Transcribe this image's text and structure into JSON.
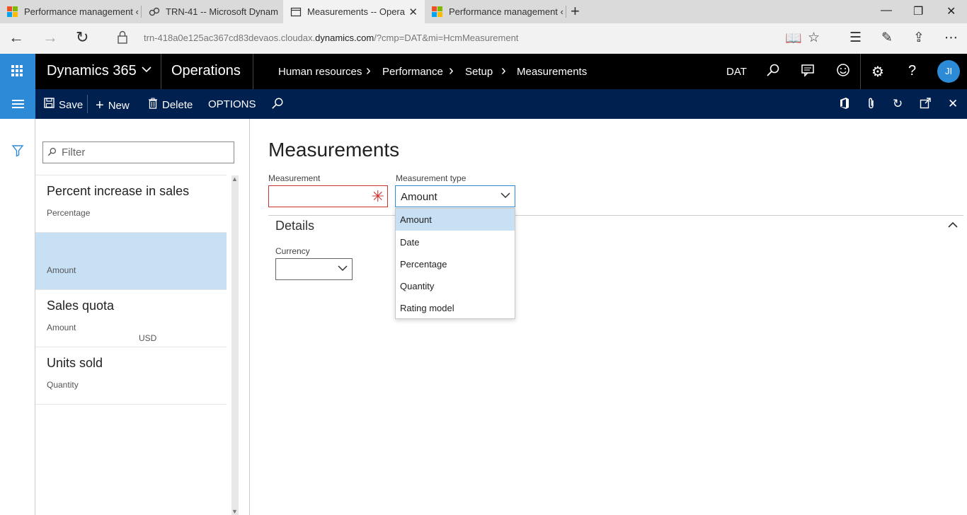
{
  "browser": {
    "tabs": [
      {
        "title": "Performance management ‹",
        "icon": "ms-logo-icon",
        "active": false
      },
      {
        "title": "TRN-41 -- Microsoft Dynam",
        "icon": "link-icon",
        "active": false
      },
      {
        "title": "Measurements -- Opera",
        "icon": "page-icon",
        "active": true
      },
      {
        "title": "Performance management ‹",
        "icon": "ms-logo-icon",
        "active": false
      }
    ],
    "new_tab": "+",
    "url_prefix": "trn-418a0e125ac367cd83devaos.cloudax.",
    "url_domain": "dynamics.com",
    "url_suffix": "/?cmp=DAT&mi=HcmMeasurement"
  },
  "topnav": {
    "brand": "Dynamics 365",
    "module": "Operations",
    "breadcrumb": [
      "Human resources",
      "Performance",
      "Setup",
      "Measurements"
    ],
    "company": "DAT",
    "avatar_initials": "JI"
  },
  "actions": {
    "save": "Save",
    "new": "New",
    "delete": "Delete",
    "options": "OPTIONS"
  },
  "list": {
    "filter_placeholder": "Filter",
    "items": [
      {
        "title": "Percent increase in sales",
        "type": "Percentage",
        "currency": "",
        "selected": false
      },
      {
        "title": "",
        "type": "Amount",
        "currency": "",
        "selected": true
      },
      {
        "title": "Sales quota",
        "type": "Amount",
        "currency": "USD",
        "selected": false
      },
      {
        "title": "Units sold",
        "type": "Quantity",
        "currency": "",
        "selected": false
      }
    ]
  },
  "form": {
    "title": "Measurements",
    "measurement_label": "Measurement",
    "measurement_value": "",
    "measurement_type_label": "Measurement type",
    "measurement_type_value": "Amount",
    "details_title": "Details",
    "currency_label": "Currency",
    "currency_value": ""
  },
  "dropdown": {
    "options": [
      "Amount",
      "Date",
      "Percentage",
      "Quantity",
      "Rating model"
    ],
    "selected_index": 0
  },
  "colors": {
    "brand_blue": "#2d8ad6",
    "nav_black": "#000000",
    "action_navy": "#002050",
    "selection": "#c7e0f4",
    "required_red": "#cc3333"
  }
}
